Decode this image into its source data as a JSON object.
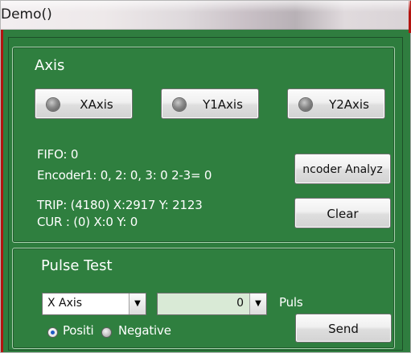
{
  "window": {
    "title": "Demo()"
  },
  "axis_group": {
    "title": "Axis",
    "buttons": [
      {
        "label": "XAxis"
      },
      {
        "label": "Y1Axis"
      },
      {
        "label": "Y2Axis"
      }
    ],
    "fifo": "FIFO: 0",
    "encoder": "Encoder1: 0, 2: 0, 3: 0 2-3= 0",
    "trip": "TRIP: (4180) X:2917 Y: 2123",
    "cur": "CUR : (0) X:0 Y: 0",
    "encoder_analyze_label": "ncoder Analyz",
    "clear_label": "Clear"
  },
  "pulse_group": {
    "title": "Pulse Test",
    "axis_select": {
      "value": "X Axis"
    },
    "pulse_count": {
      "value": "0"
    },
    "unit_label": "Puls",
    "radio_positive": "Positi",
    "radio_negative": "Negative",
    "send_label": "Send"
  }
}
